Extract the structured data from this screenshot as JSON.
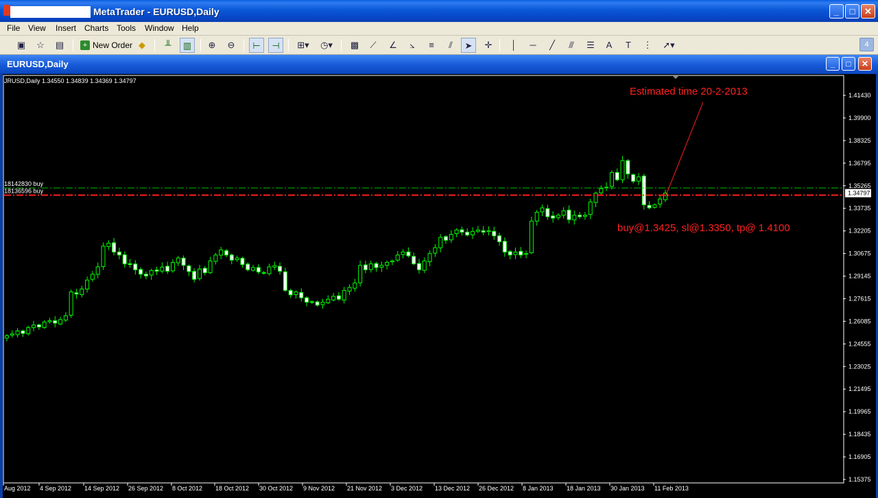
{
  "window": {
    "title": "MetaTrader - EURUSD,Daily",
    "minimize_glyph": "_",
    "maximize_glyph": "□",
    "close_glyph": "✕"
  },
  "menu": [
    "File",
    "View",
    "Insert",
    "Charts",
    "Tools",
    "Window",
    "Help"
  ],
  "toolbar": {
    "new_order_label": "New Order",
    "counter": "4"
  },
  "chart_window": {
    "title": "EURUSD,Daily"
  },
  "chart_data": {
    "type": "candlestick",
    "symbol_info": "JRUSD,Daily  1.34550 1.34839 1.34369 1.34797",
    "y_ticks": [
      "1.41430",
      "1.39900",
      "1.38325",
      "1.36795",
      "1.35265",
      "1.33735",
      "1.32205",
      "1.30675",
      "1.29145",
      "1.27615",
      "1.26085",
      "1.24555",
      "1.23025",
      "1.21495",
      "1.19965",
      "1.18435",
      "1.16905",
      "1.15375"
    ],
    "x_ticks": [
      "Aug 2012",
      "4 Sep 2012",
      "14 Sep 2012",
      "26 Sep 2012",
      "8 Oct 2012",
      "18 Oct 2012",
      "30 Oct 2012",
      "9 Nov 2012",
      "21 Nov 2012",
      "3 Dec 2012",
      "13 Dec 2012",
      "26 Dec 2012",
      "8 Jan 2013",
      "18 Jan 2013",
      "30 Jan 2013",
      "11 Feb 2013"
    ],
    "current_price": "1.34797",
    "order_lines": [
      {
        "label": "18142830 buy",
        "price": 1.3515,
        "color": "#00c000"
      },
      {
        "label": "18136596 buy",
        "price": 1.3466,
        "color": "#ff2020"
      }
    ],
    "annotations": {
      "estimate_text": "Estimated time 20-2-2013",
      "trade_text": "buy@1.3425, sl@1.3350,  tp@ 1.4100"
    },
    "closes": [
      1.2512,
      1.2525,
      1.2545,
      1.2528,
      1.2568,
      1.2585,
      1.2572,
      1.2605,
      1.2615,
      1.2598,
      1.2622,
      1.2648,
      1.281,
      1.2795,
      1.283,
      1.289,
      1.293,
      1.298,
      1.312,
      1.314,
      1.308,
      1.306,
      1.3,
      1.2995,
      1.296,
      1.293,
      1.2918,
      1.2955,
      1.295,
      1.2978,
      1.295,
      1.301,
      1.304,
      1.299,
      1.2948,
      1.2895,
      1.2965,
      1.294,
      1.302,
      1.306,
      1.3095,
      1.306,
      1.3025,
      1.304,
      1.2995,
      1.296,
      1.2975,
      1.2945,
      1.2938,
      1.298,
      1.2988,
      1.295,
      1.282,
      1.279,
      1.281,
      1.277,
      1.274,
      1.274,
      1.272,
      1.274,
      1.276,
      1.278,
      1.276,
      1.282,
      1.284,
      1.287,
      1.299,
      1.296,
      1.3,
      1.2975,
      1.299,
      1.301,
      1.302,
      1.306,
      1.308,
      1.3055,
      1.3,
      1.296,
      1.302,
      1.307,
      1.311,
      1.318,
      1.316,
      1.32,
      1.323,
      1.3215,
      1.3195,
      1.322,
      1.323,
      1.3215,
      1.3225,
      1.319,
      1.315,
      1.308,
      1.306,
      1.308,
      1.306,
      1.307,
      1.329,
      1.335,
      1.338,
      1.332,
      1.331,
      1.333,
      1.336,
      1.33,
      1.333,
      1.332,
      1.333,
      1.342,
      1.348,
      1.351,
      1.352,
      1.362,
      1.357,
      1.37,
      1.361,
      1.356,
      1.359,
      1.34,
      1.338,
      1.34,
      1.344,
      1.348
    ],
    "ylim": [
      1.15375,
      1.4143
    ]
  }
}
